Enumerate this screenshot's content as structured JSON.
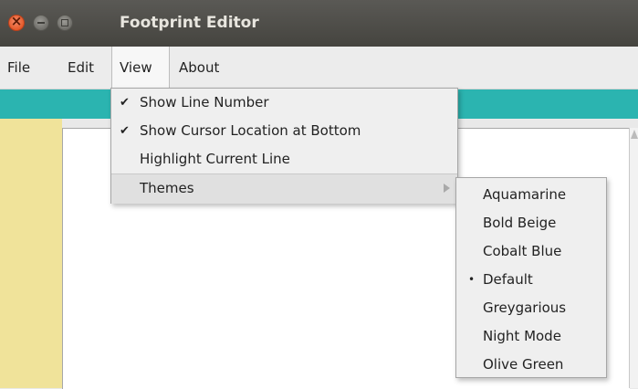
{
  "window": {
    "title": "Footprint Editor",
    "close_icon": "close-icon",
    "minimize_icon": "minimize-icon",
    "maximize_icon": "maximize-icon"
  },
  "menubar": {
    "items": [
      {
        "label": "File"
      },
      {
        "label": "Edit"
      },
      {
        "label": "View",
        "active": true
      },
      {
        "label": "About"
      }
    ]
  },
  "colors": {
    "toolbar_band": "#2bb4b0",
    "gutter": "#f0e39a",
    "titlebar": "#45443f"
  },
  "view_menu": {
    "items": [
      {
        "label": "Show Line Number",
        "check": "✔"
      },
      {
        "label": "Show Cursor Location at Bottom",
        "check": "✔"
      },
      {
        "label": "Highlight Current Line",
        "check": ""
      },
      {
        "label": "Themes",
        "check": "",
        "submenu": true
      }
    ]
  },
  "themes_menu": {
    "items": [
      {
        "label": "Aquamarine",
        "bullet": ""
      },
      {
        "label": "Bold Beige",
        "bullet": ""
      },
      {
        "label": "Cobalt Blue",
        "bullet": ""
      },
      {
        "label": "Default",
        "bullet": "•"
      },
      {
        "label": "Greygarious",
        "bullet": ""
      },
      {
        "label": "Night Mode",
        "bullet": ""
      },
      {
        "label": "Olive Green",
        "bullet": ""
      }
    ]
  }
}
